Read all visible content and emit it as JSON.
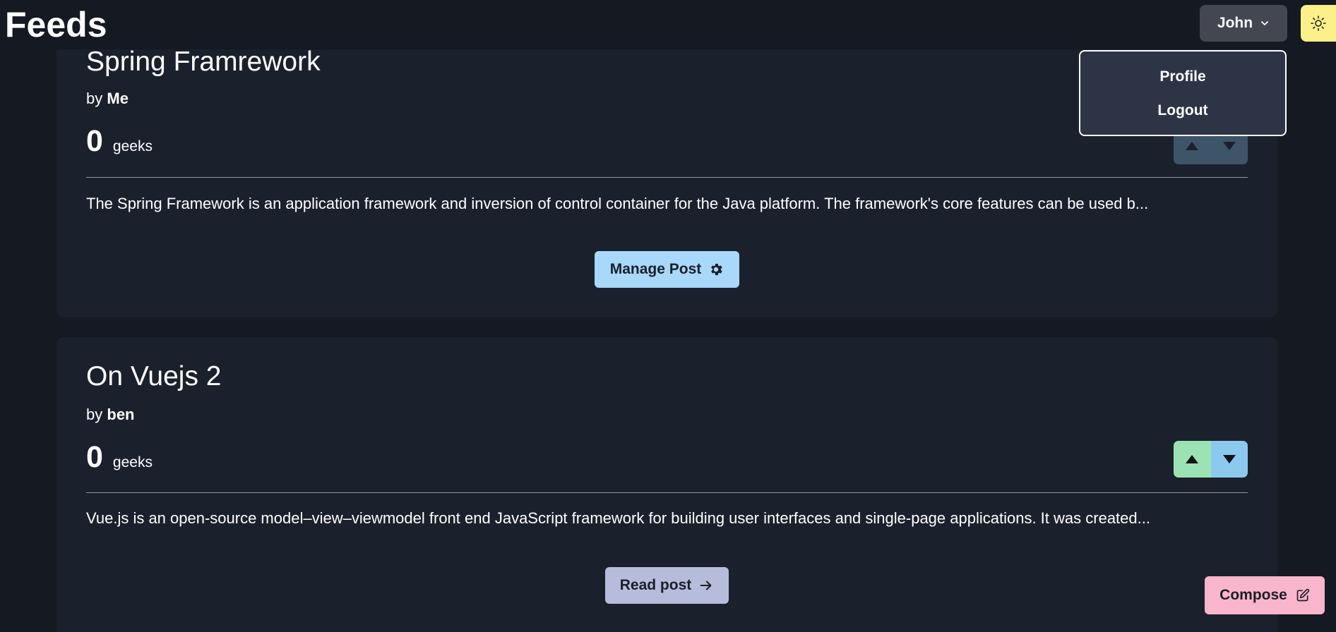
{
  "header": {
    "title": "Feeds",
    "user_menu_label": "John",
    "theme_icon": "sun-icon"
  },
  "user_dropdown": {
    "items": [
      {
        "label": "Profile"
      },
      {
        "label": "Logout"
      }
    ]
  },
  "posts": [
    {
      "title": "Spring Framrework",
      "by_prefix": "by",
      "author": "Me",
      "score": "0",
      "score_unit": "geeks",
      "excerpt": "The Spring Framework is an application framework and inversion of control container for the Java platform. The framework's core features can be used b...",
      "action_label": "Manage Post",
      "action_icon": "gear-icon"
    },
    {
      "title": "On Vuejs 2",
      "by_prefix": "by",
      "author": "ben",
      "score": "0",
      "score_unit": "geeks",
      "excerpt": "Vue.js is an open-source model–view–viewmodel front end JavaScript framework for building user interfaces and single-page applications. It was created...",
      "action_label": "Read post",
      "action_icon": "arrow-right-icon"
    }
  ],
  "compose": {
    "label": "Compose",
    "icon": "edit-icon"
  },
  "colors": {
    "background": "#141922",
    "card": "#1b212c",
    "upvote": "#9be3b2",
    "downvote": "#8cc9ef",
    "manage_button": "#a8d8fa",
    "read_button": "#b6bddb",
    "compose_button": "#f9b5cb",
    "theme_button": "#fbf08a"
  }
}
